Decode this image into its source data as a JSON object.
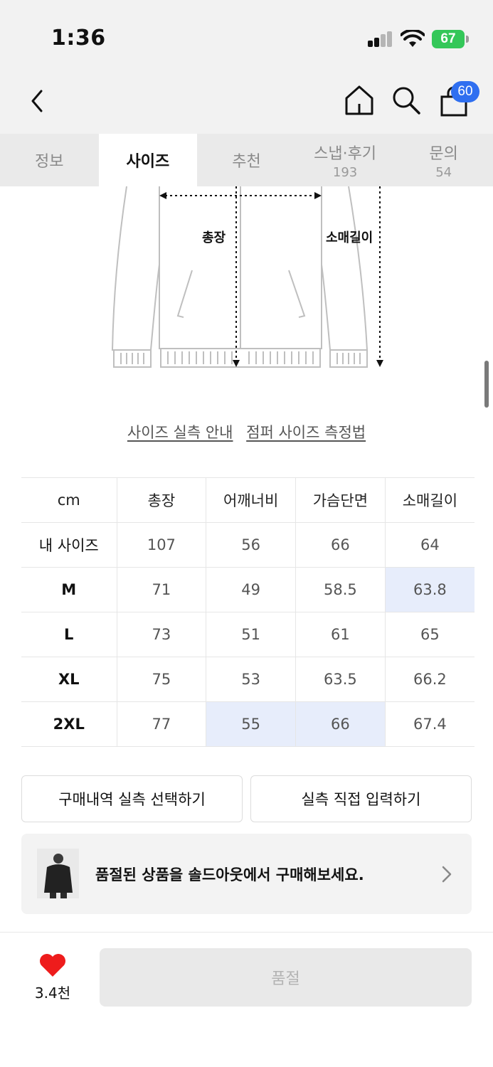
{
  "status_bar": {
    "time": "1:36",
    "battery": "67"
  },
  "nav": {
    "cart_count": "60"
  },
  "tabs": [
    {
      "label": "정보",
      "count": ""
    },
    {
      "label": "사이즈",
      "count": ""
    },
    {
      "label": "추천",
      "count": ""
    },
    {
      "label": "스냅·후기",
      "count": "193"
    },
    {
      "label": "문의",
      "count": "54"
    }
  ],
  "active_tab": "사이즈",
  "diagram": {
    "length_label": "총장",
    "sleeve_label": "소매길이"
  },
  "links": {
    "guide": "사이즈 실측 안내",
    "measure": "점퍼 사이즈 측정법"
  },
  "size_table": {
    "headers": [
      "cm",
      "총장",
      "어깨너비",
      "가슴단면",
      "소매길이"
    ],
    "rows": [
      {
        "size": "내 사이즈",
        "values": [
          "107",
          "56",
          "66",
          "64"
        ]
      },
      {
        "size": "M",
        "values": [
          "71",
          "49",
          "58.5",
          "63.8"
        ]
      },
      {
        "size": "L",
        "values": [
          "73",
          "51",
          "61",
          "65"
        ]
      },
      {
        "size": "XL",
        "values": [
          "75",
          "53",
          "63.5",
          "66.2"
        ]
      },
      {
        "size": "2XL",
        "values": [
          "77",
          "55",
          "66",
          "67.4"
        ]
      }
    ],
    "highlight_color": "#e7edfb"
  },
  "actions": {
    "history_label": "구매내역 실측 선택하기",
    "input_label": "실측 직접 입력하기"
  },
  "banner": {
    "text": "품절된 상품을 솔드아웃에서 구매해보세요."
  },
  "bottom": {
    "like_count": "3.4천",
    "soldout_label": "품절"
  },
  "colors": {
    "accent_blue": "#2f6ff0",
    "heart_red": "#ee1c1c",
    "battery_green": "#34c759"
  }
}
